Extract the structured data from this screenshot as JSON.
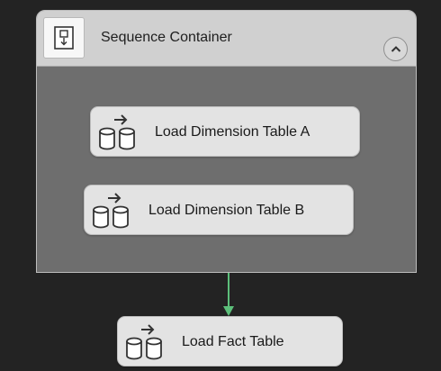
{
  "sequence_container": {
    "title": "Sequence Container",
    "icon": "sequence-container-icon",
    "collapse_icon": "chevron-up-icon",
    "tasks": [
      {
        "label": "Load Dimension Table A",
        "icon": "data-flow-task-icon"
      },
      {
        "label": "Load Dimension Table B",
        "icon": "data-flow-task-icon"
      }
    ]
  },
  "fact_task": {
    "label": "Load Fact Table",
    "icon": "data-flow-task-icon"
  },
  "precedence_constraint": {
    "type": "success",
    "color": "#5cbf7a"
  },
  "colors": {
    "canvas_background": "#232323",
    "container_body": "#6e6e6e",
    "container_header": "#d0d0d0",
    "task_background": "#e3e3e3"
  }
}
